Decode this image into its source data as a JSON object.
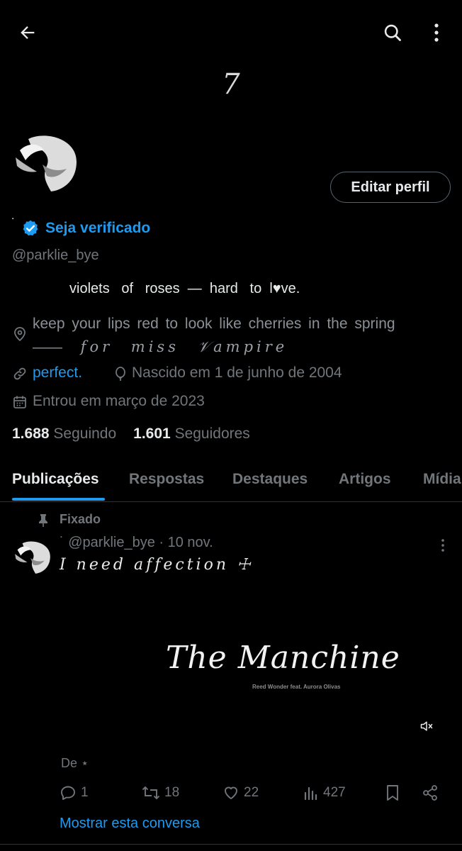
{
  "header": {
    "back_icon": "arrow-left-icon",
    "search_icon": "search-icon",
    "more_icon": "more-vertical-icon",
    "banner_text": "7"
  },
  "profile": {
    "display_name": "˙",
    "verify_label": "Seja verificado",
    "edit_button": "Editar perfil",
    "handle": "@parklie_bye",
    "bio_line": "violets   of   roses  —  hard   to  l♥ve.",
    "location_plain": "   keep  your  lips  red   to  look  like  cherries  in the spring  ——",
    "location_fancy": " for  miss  𝒱ampire",
    "website": "perfect.",
    "birthday": "Nascido em 1 de junho de 2004",
    "joined": "Entrou em março de 2023",
    "following_count": "1.688",
    "following_label": "Seguindo",
    "followers_count": "1.601",
    "followers_label": "Seguidores"
  },
  "tabs": [
    {
      "label": "Publicações",
      "active": true
    },
    {
      "label": "Respostas"
    },
    {
      "label": "Destaques"
    },
    {
      "label": "Artigos"
    },
    {
      "label": "Mídia"
    }
  ],
  "post": {
    "pinned_label": "Fixado",
    "author_prefix": "˙",
    "handle_date": "@parklie_bye · 10 nov.",
    "text": "I need affection ☩",
    "media_title": "The Manchine",
    "media_subtitle": "Reed Wonder feat. Aurora Olivas",
    "translate_text": "De ⋆",
    "replies": "1",
    "reposts": "18",
    "likes": "22",
    "views": "427",
    "show_thread": "Mostrar esta conversa"
  },
  "colors": {
    "accent": "#1d9bf0",
    "background": "#000000",
    "text": "#e7e9ea",
    "muted": "#71767b"
  }
}
